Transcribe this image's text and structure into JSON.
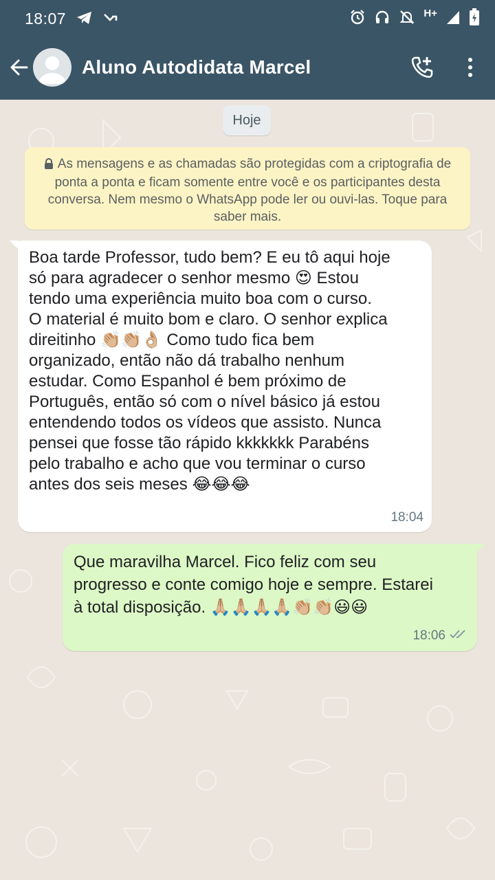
{
  "status_bar": {
    "time": "18:07",
    "network_label": "H+",
    "left_icons": [
      "telegram-icon",
      "missed-call-icon"
    ],
    "right_icons": [
      "alarm-icon",
      "headset-icon",
      "notifications-off-icon",
      "signal-icon",
      "battery-charging-icon"
    ]
  },
  "header": {
    "contact_name": "Aluno Autodidata Marcel",
    "icons": [
      "back-arrow-icon",
      "avatar-placeholder-icon",
      "add-call-icon",
      "more-options-icon"
    ],
    "bar_color": "#3a5566"
  },
  "chat": {
    "date_chip": "Hoje",
    "encryption_notice": "As mensagens e as chamadas são protegidas com a criptografia de ponta a ponta e ficam somente entre você e os participantes desta conversa. Nem mesmo o WhatsApp pode ler ou ouvi-las. Toque para saber mais.",
    "messages": [
      {
        "direction": "incoming",
        "text": "Boa tarde Professor, tudo bem? E eu tô aqui hoje\nsó para agradecer o senhor mesmo 😍 Estou\ntendo uma experiência muito boa com o curso.\nO material é muito bom e claro. O senhor explica\ndireitinho 👏🏼👏🏼👌🏼 Como tudo fica bem\norganizado, então não dá trabalho nenhum\nestudar. Como Espanhol é bem próximo de\nPortuguês, então só com o nível básico já estou\nentendendo todos os vídeos que assisto. Nunca\npensei que fosse tão rápido kkkkkkk Parabéns\npelo trabalho e acho que vou terminar o curso\nantes dos seis meses 😂😂😂",
        "time": "18:04",
        "bubble_color": "#ffffff"
      },
      {
        "direction": "outgoing",
        "text": "Que maravilha Marcel. Fico feliz com seu\nprogresso e conte comigo hoje e sempre. Estarei\nà total disposição. 🙏🏼🙏🏼🙏🏼🙏🏼👏🏼👏🏼😃😃",
        "time": "18:06",
        "status_icon": "double-check-icon",
        "bubble_color": "#dcf8c6"
      }
    ],
    "notice_color": "#fdf4c5",
    "background_color": "#ece5dd"
  }
}
